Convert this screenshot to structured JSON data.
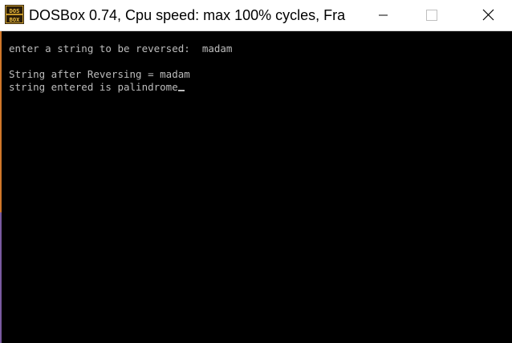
{
  "window": {
    "title": "DOSBox 0.74, Cpu speed: max 100% cycles, Fra",
    "icon": "dosbox-icon",
    "controls": [
      "minimize-icon",
      "maximize-icon",
      "close-icon"
    ]
  },
  "console": {
    "lines": [
      "enter a string to be reversed:  madam",
      "String after Reversing = madam",
      "string entered is palindrome"
    ],
    "text_color": "#bdbdbd",
    "background": "#000000"
  }
}
